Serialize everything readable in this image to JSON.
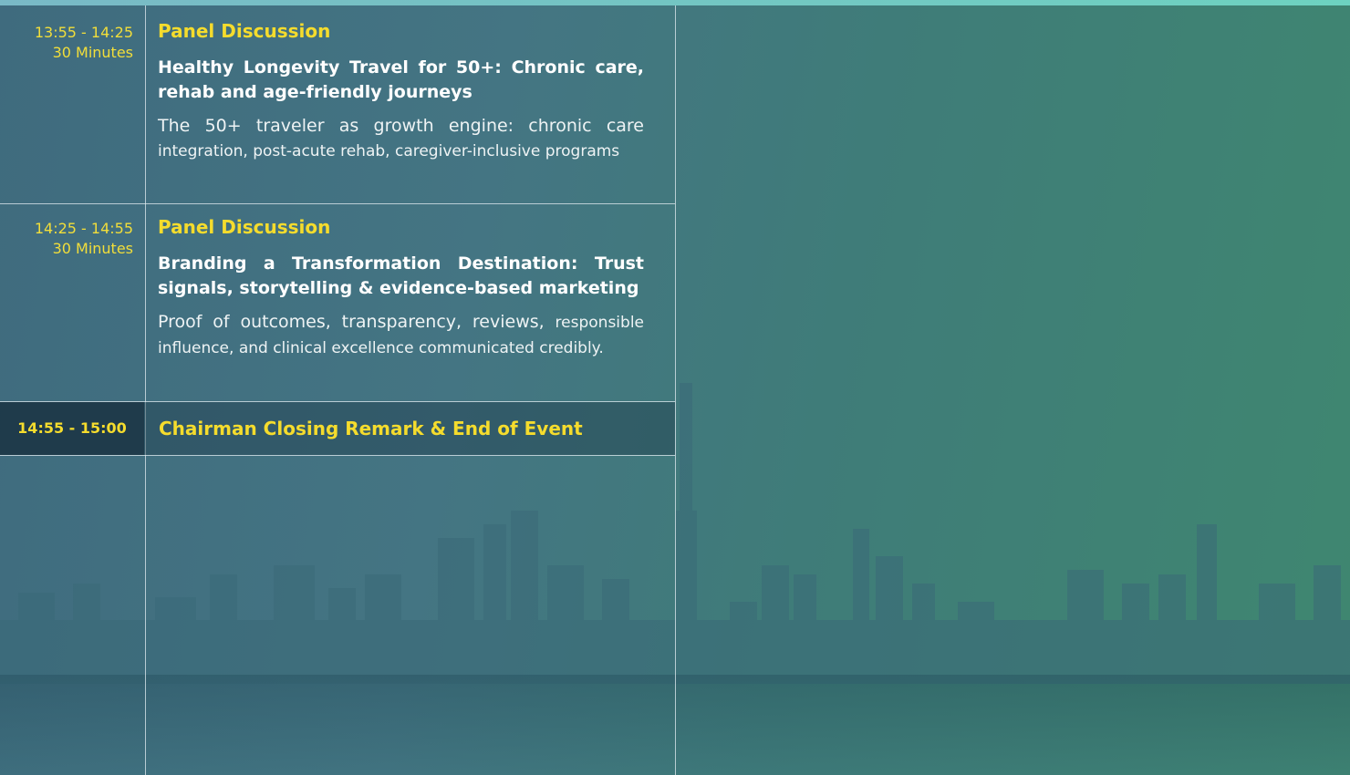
{
  "schedule": {
    "sessions": [
      {
        "time_range": "13:55 - 14:25",
        "duration": "30 Minutes",
        "type": "Panel Discussion",
        "title": "Healthy Longevity Travel for 50+: Chronic care, rehab and age-friendly journeys",
        "description_lead": "The 50+ traveler as growth engine: chronic care",
        "description_rest": "integration, post-acute rehab, caregiver-inclusive programs"
      },
      {
        "time_range": "14:25 - 14:55",
        "duration": "30 Minutes",
        "type": "Panel Discussion",
        "title": "Branding a Transformation Destination: Trust signals, storytelling & evidence-based marketing",
        "description_lead": "Proof of outcomes, transparency, reviews,",
        "description_rest": "responsible influence, and clinical excellence communicated credibly."
      }
    ],
    "closing": {
      "time_range": "14:55 - 15:00",
      "title": "Chairman Closing Remark & End of Event"
    }
  }
}
